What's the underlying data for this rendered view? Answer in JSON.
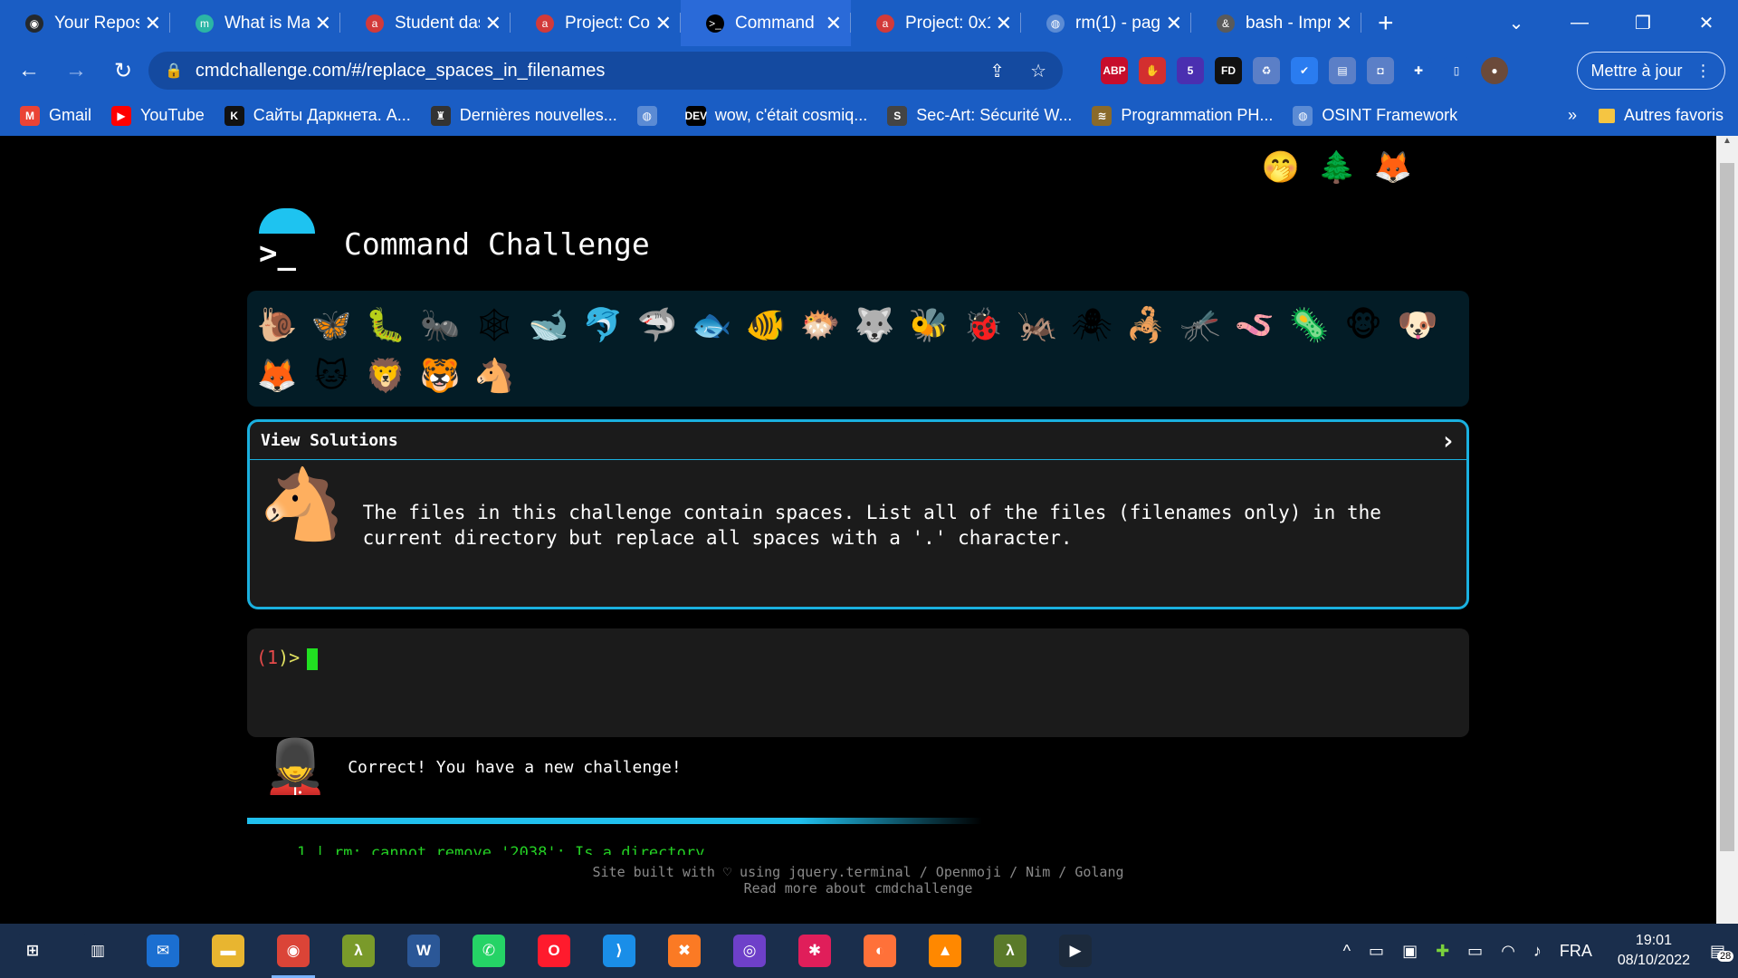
{
  "browser": {
    "tabs": [
      {
        "title": "Your Reposi",
        "favicon": "github-icon",
        "color": "#24292e",
        "glyph": "◉"
      },
      {
        "title": "What is Mal",
        "favicon": "medium-icon",
        "color": "#2bb5a5",
        "glyph": "m"
      },
      {
        "title": "Student das",
        "favicon": "alx-icon",
        "color": "#d23a3a",
        "glyph": "a"
      },
      {
        "title": "Project: Cor",
        "favicon": "alx-icon",
        "color": "#d23a3a",
        "glyph": "a"
      },
      {
        "title": "Command",
        "favicon": "terminal-icon",
        "color": "#000000",
        "glyph": ">_"
      },
      {
        "title": "Project: 0x1",
        "favicon": "alx-icon",
        "color": "#d23a3a",
        "glyph": "a"
      },
      {
        "title": "rm(1) - pag",
        "favicon": "globe-icon",
        "color": "#5b8bd4",
        "glyph": "◍"
      },
      {
        "title": "bash - Impr",
        "favicon": "bash-icon",
        "color": "#5a5a5a",
        "glyph": "&"
      }
    ],
    "new_tab_label": "+",
    "close_label": "✕",
    "url": "cmdchallenge.com/#/replace_spaces_in_filenames",
    "update_label": "Mettre à jour",
    "bookmarks": [
      {
        "label": "Gmail",
        "icon": "gmail-icon",
        "glyph": "M",
        "color": "#ea4335"
      },
      {
        "label": "YouTube",
        "icon": "youtube-icon",
        "glyph": "▶",
        "color": "#ff0000"
      },
      {
        "label": "Сайты Даркнета. А...",
        "icon": "k-icon",
        "glyph": "K",
        "color": "#111111"
      },
      {
        "label": "Dernières nouvelles...",
        "icon": "news-icon",
        "glyph": "♜",
        "color": "#333333"
      },
      {
        "label": "",
        "icon": "globe-icon",
        "glyph": "◍",
        "color": "#5b8bd4"
      },
      {
        "label": "wow, c'était cosmiq...",
        "icon": "dev-icon",
        "glyph": "DEV",
        "color": "#000000"
      },
      {
        "label": "Sec-Art: Sécurité W...",
        "icon": "secart-icon",
        "glyph": "S",
        "color": "#444444"
      },
      {
        "label": "Programmation PH...",
        "icon": "php-icon",
        "glyph": "≋",
        "color": "#8a6a2a"
      },
      {
        "label": "OSINT Framework",
        "icon": "globe-icon",
        "glyph": "◍",
        "color": "#5b8bd4"
      }
    ],
    "bookmarks_more": "»",
    "other_bookmarks": "Autres favoris",
    "extensions": [
      {
        "name": "adblock-plus-icon",
        "glyph": "ABP",
        "color": "#c70d2c"
      },
      {
        "name": "adblock-icon",
        "glyph": "✋",
        "color": "#d32f2f"
      },
      {
        "name": "extension-badge-icon",
        "glyph": "5",
        "color": "#4a2fb0"
      },
      {
        "name": "fd-icon",
        "glyph": "FD",
        "color": "#111111"
      },
      {
        "name": "recycle-icon",
        "glyph": "♻",
        "color": "#5b7fc7"
      },
      {
        "name": "todoist-icon",
        "glyph": "✔",
        "color": "#2a7cf0"
      },
      {
        "name": "stack-icon",
        "glyph": "▤",
        "color": "#5b7fc7"
      },
      {
        "name": "camera-icon",
        "glyph": "◘",
        "color": "#5b7fc7"
      },
      {
        "name": "puzzle-icon",
        "glyph": "✚",
        "color": "#1a5dc4"
      },
      {
        "name": "sidebar-icon",
        "glyph": "▯",
        "color": "#1a5dc4"
      },
      {
        "name": "profile-avatar-icon",
        "glyph": "●",
        "color": "#6b4a3a"
      }
    ]
  },
  "site": {
    "title": "Command Challenge",
    "logo_prompt": ">_",
    "top_icons": [
      "🖥",
      "🤭",
      "🌲",
      "🦊",
      "✉"
    ],
    "top_icon_names": [
      "terminal-icon",
      "hand-over-mouth-icon",
      "tree-icon",
      "gitlab-icon",
      "mail-icon"
    ],
    "animals": [
      "🐌",
      "🦋",
      "🐛",
      "🐜",
      "🕸",
      "🐋",
      "🐬",
      "🦈",
      "🐟",
      "🐠",
      "🐡",
      "🐺",
      "🐝",
      "🐞",
      "🦗",
      "🕷",
      "🦂",
      "🦟",
      "🪱",
      "🦠",
      "🐵",
      "🐶",
      "🦊",
      "🐱",
      "🦁",
      "🐯",
      "🐴"
    ],
    "panel_header": "View Solutions",
    "panel_chevron": "›",
    "challenge_icon": "🐴",
    "challenge_text": "The files in this challenge contain spaces. List all of the files (filenames only) in the current directory but replace all spaces with a '.' character.",
    "prompt_open": "(",
    "prompt_num": "1",
    "prompt_close": ")>",
    "success_icon": "💂",
    "success_text": "Correct! You have a new challenge!",
    "log_line": "1 | rm: cannot remove '2038': Is a directory",
    "footer_line1": "Site built with ♡ using jquery.terminal / Openmoji / Nim / Golang",
    "footer_line2": "Read more about cmdchallenge"
  },
  "taskbar": {
    "apps": [
      {
        "name": "start-icon",
        "glyph": "⊞",
        "color": "#1a2e4c"
      },
      {
        "name": "task-view-icon",
        "glyph": "▥",
        "color": "#1a2e4c"
      },
      {
        "name": "mail-icon",
        "glyph": "✉",
        "color": "#1b6fd1"
      },
      {
        "name": "file-explorer-icon",
        "glyph": "▬",
        "color": "#e8b530"
      },
      {
        "name": "chrome-icon",
        "glyph": "◉",
        "color": "#db4437"
      },
      {
        "name": "lambda-icon",
        "glyph": "λ",
        "color": "#7a9a2a"
      },
      {
        "name": "word-icon",
        "glyph": "W",
        "color": "#2b5797"
      },
      {
        "name": "whatsapp-icon",
        "glyph": "✆",
        "color": "#25d366"
      },
      {
        "name": "opera-icon",
        "glyph": "O",
        "color": "#ff1b2d"
      },
      {
        "name": "vscode-icon",
        "glyph": "⟩",
        "color": "#1a8ee8"
      },
      {
        "name": "xampp-icon",
        "glyph": "✖",
        "color": "#fb7a24"
      },
      {
        "name": "github-desktop-icon",
        "glyph": "◎",
        "color": "#6e40c9"
      },
      {
        "name": "slack-icon",
        "glyph": "✱",
        "color": "#e01e5a"
      },
      {
        "name": "firefox-icon",
        "glyph": "◐",
        "color": "#ff7139"
      },
      {
        "name": "vlc-icon",
        "glyph": "▲",
        "color": "#ff8800"
      },
      {
        "name": "lambda-folder-icon",
        "glyph": "λ",
        "color": "#5a7a2a"
      },
      {
        "name": "cmdchallenge-icon",
        "glyph": "▶",
        "color": "#1c2a3c"
      }
    ],
    "lang": "FRA",
    "time": "19:01",
    "date": "08/10/2022",
    "notifications": "28"
  }
}
